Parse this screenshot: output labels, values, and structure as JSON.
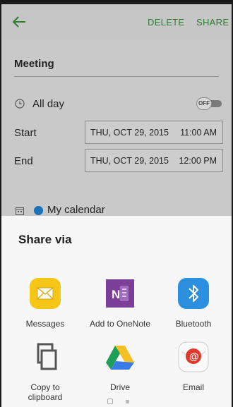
{
  "appbar": {
    "delete_label": "DELETE",
    "share_label": "SHARE"
  },
  "event": {
    "title": "Meeting",
    "allday_label": "All day",
    "allday_toggle": "OFF",
    "start_label": "Start",
    "start_date": "THU, OCT 29, 2015",
    "start_time": "11:00 AM",
    "end_label": "End",
    "end_date": "THU, OCT 29, 2015",
    "end_time": "12:00 PM",
    "calendar_name": "My calendar"
  },
  "share": {
    "title": "Share via",
    "apps": [
      {
        "label": "Messages",
        "icon": "messages-icon"
      },
      {
        "label": "Add to OneNote",
        "icon": "onenote-icon"
      },
      {
        "label": "Bluetooth",
        "icon": "bluetooth-icon"
      },
      {
        "label": "Copy to clipboard",
        "icon": "copy-clipboard-icon"
      },
      {
        "label": "Drive",
        "icon": "drive-icon"
      },
      {
        "label": "Email",
        "icon": "email-icon"
      }
    ]
  },
  "colors": {
    "accent": "#2e7d32",
    "calendar_dot": "#1a73b8",
    "messages": "#f5c518",
    "onenote": "#7b3f98",
    "bluetooth": "#2d8fe0"
  }
}
